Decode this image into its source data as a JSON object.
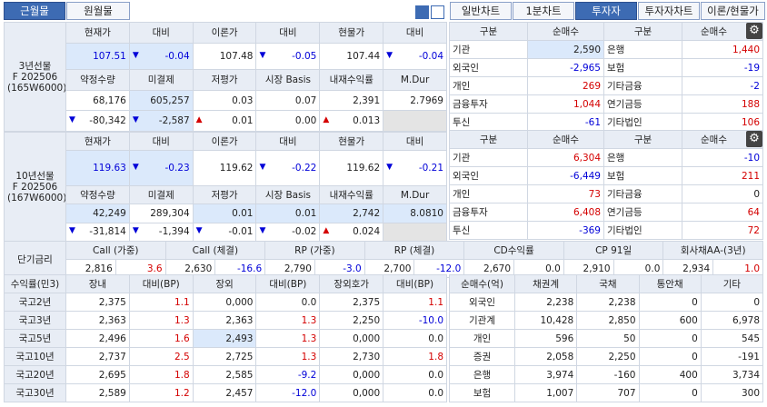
{
  "tabs_left": [
    "근월물",
    "원월물"
  ],
  "tabs_right": [
    "일반차트",
    "1분차트",
    "투자자",
    "투자자차트",
    "이론/현물가"
  ],
  "f3": {
    "label": "3년선물\nF 202506\n(165W6000)",
    "h1": [
      "현재가",
      "대비",
      "이론가",
      "대비",
      "현물가",
      "대비"
    ],
    "r1": [
      "107.51",
      "-0.04",
      "107.48",
      "-0.05",
      "107.44",
      "-0.04"
    ],
    "h2": [
      "약정수량",
      "미결제",
      "저평가",
      "시장 Basis",
      "내재수익률",
      "M.Dur"
    ],
    "r2": [
      "68,176",
      "605,257",
      "0.03",
      "0.07",
      "2,391",
      "2.7969"
    ],
    "r3": [
      "-80,342",
      "-2,587",
      "0.01",
      "0.00",
      "0.013",
      ""
    ]
  },
  "f10": {
    "label": "10년선물\nF 202506\n(167W6000)",
    "h1": [
      "현재가",
      "대비",
      "이론가",
      "대비",
      "현물가",
      "대비"
    ],
    "r1": [
      "119.63",
      "-0.23",
      "119.62",
      "-0.22",
      "119.62",
      "-0.21"
    ],
    "h2": [
      "약정수량",
      "미결제",
      "저평가",
      "시장 Basis",
      "내재수익률",
      "M.Dur"
    ],
    "r2": [
      "42,249",
      "289,304",
      "0.01",
      "0.01",
      "2,742",
      "8.0810"
    ],
    "r3": [
      "-31,814",
      "-1,394",
      "-0.01",
      "-0.02",
      "0.024",
      ""
    ]
  },
  "inv3": {
    "headers": [
      "구분",
      "순매수",
      "구분",
      "순매수"
    ],
    "rows": [
      [
        "기관",
        "2,590",
        "은행",
        "1,440"
      ],
      [
        "외국인",
        "-2,965",
        "보험",
        "-19"
      ],
      [
        "개인",
        "269",
        "기타금융",
        "-2"
      ],
      [
        "금융투자",
        "1,044",
        "연기금등",
        "188"
      ],
      [
        "투신",
        "-61",
        "기타법인",
        "106"
      ]
    ]
  },
  "inv10": {
    "headers": [
      "구분",
      "순매수",
      "구분",
      "순매수"
    ],
    "rows": [
      [
        "기관",
        "6,304",
        "은행",
        "-10"
      ],
      [
        "외국인",
        "-6,449",
        "보험",
        "211"
      ],
      [
        "개인",
        "73",
        "기타금융",
        "0"
      ],
      [
        "금융투자",
        "6,408",
        "연기금등",
        "64"
      ],
      [
        "투신",
        "-369",
        "기타법인",
        "72"
      ]
    ]
  },
  "short": {
    "label": "단기금리",
    "headers": [
      "Call (가중)",
      "Call (체결)",
      "RP (가중)",
      "RP (체결)",
      "CD수익률",
      "CP 91일",
      "회사채AA-(3년)"
    ],
    "values": [
      "2,816",
      "3.6",
      "2,630",
      "-16.6",
      "2,790",
      "-3.0",
      "2,700",
      "-12.0",
      "2,670",
      "0.0",
      "2,910",
      "0.0",
      "2,934",
      "1.0"
    ]
  },
  "yield": {
    "headers": [
      "수익률(민3)",
      "장내",
      "대비(BP)",
      "장외",
      "대비(BP)",
      "장외호가",
      "대비(BP)"
    ],
    "rows": [
      [
        "국고2년",
        "2,375",
        "1.1",
        "0,000",
        "0.0",
        "2,375",
        "1.1"
      ],
      [
        "국고3년",
        "2,363",
        "1.3",
        "2,363",
        "1.3",
        "2,250",
        "-10.0"
      ],
      [
        "국고5년",
        "2,496",
        "1.6",
        "2,493",
        "1.3",
        "0,000",
        "0.0"
      ],
      [
        "국고10년",
        "2,737",
        "2.5",
        "2,725",
        "1.3",
        "2,730",
        "1.8"
      ],
      [
        "국고20년",
        "2,695",
        "1.8",
        "2,585",
        "-9.2",
        "0,000",
        "0.0"
      ],
      [
        "국고30년",
        "2,589",
        "1.2",
        "2,457",
        "-12.0",
        "0,000",
        "0.0"
      ]
    ]
  },
  "netbuy": {
    "headers": [
      "순매수(억)",
      "채권계",
      "국채",
      "통안채",
      "기타"
    ],
    "rows": [
      [
        "외국인",
        "2,238",
        "2,238",
        "0",
        "0"
      ],
      [
        "기관계",
        "10,428",
        "2,850",
        "600",
        "6,978"
      ],
      [
        "개인",
        "596",
        "50",
        "0",
        "545"
      ],
      [
        "증권",
        "2,058",
        "2,250",
        "0",
        "-191"
      ],
      [
        "은행",
        "3,974",
        "-160",
        "400",
        "3,734"
      ],
      [
        "보험",
        "1,007",
        "707",
        "0",
        "300"
      ]
    ]
  }
}
